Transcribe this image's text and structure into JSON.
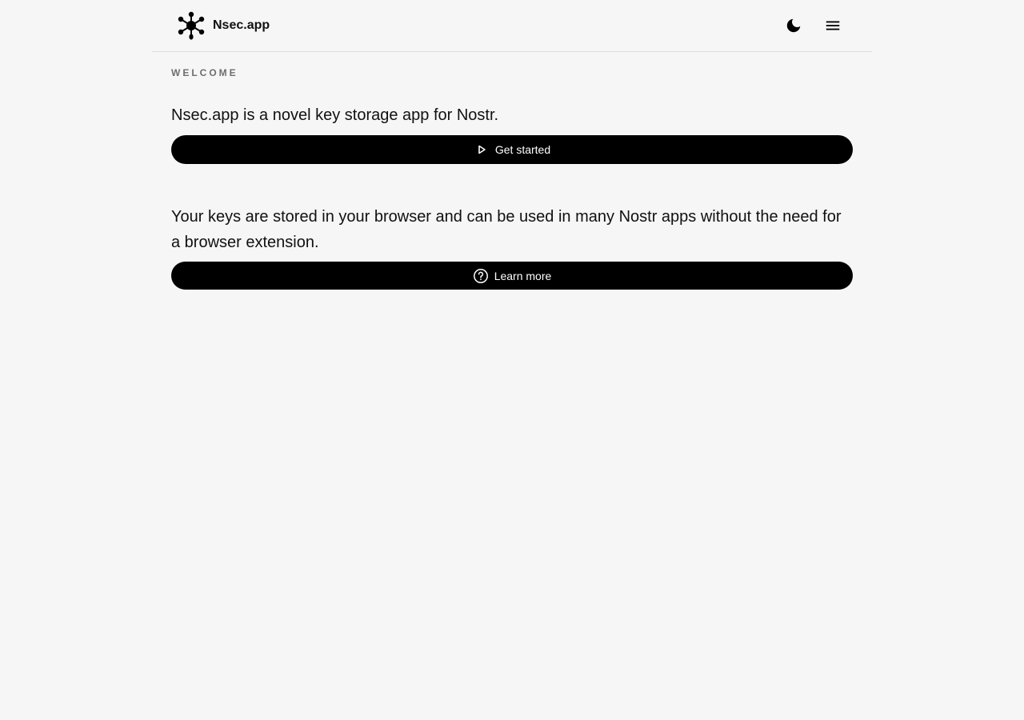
{
  "header": {
    "brand_name": "Nsec.app",
    "logo_icon": "nostr-network-logo-icon",
    "theme_toggle_icon": "moon-icon",
    "menu_icon": "hamburger-menu-icon"
  },
  "main": {
    "section_label": "WELCOME",
    "intro_text": "Nsec.app is a novel key storage app for Nostr.",
    "get_started": {
      "label": "Get started",
      "icon": "play-icon"
    },
    "description_text": "Your keys are stored in your browser and can be used in many Nostr apps without the need for a browser extension.",
    "learn_more": {
      "label": "Learn more",
      "icon": "help-circle-icon"
    }
  },
  "colors": {
    "background": "#f6f6f6",
    "button": "#000000",
    "button_text": "#ffffff",
    "label_muted": "#6e6e6e"
  }
}
